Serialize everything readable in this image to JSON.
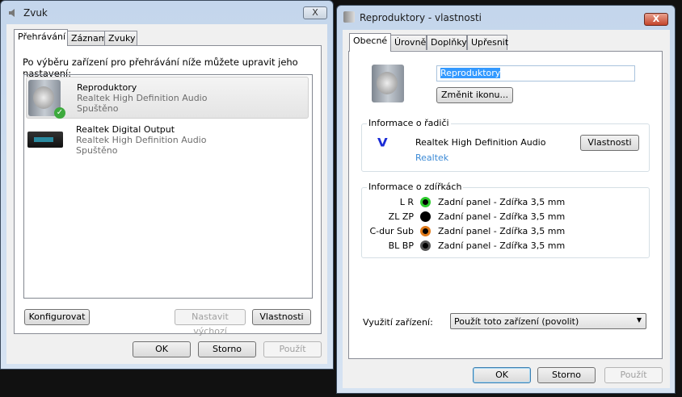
{
  "sound_window": {
    "title": "Zvuk",
    "close_label": "X",
    "tabs": [
      {
        "label": "Přehrávání"
      },
      {
        "label": "Záznam"
      },
      {
        "label": "Zvuky"
      }
    ],
    "description": "Po výběru zařízení pro přehrávání níže můžete upravit jeho nastavení:",
    "devices": [
      {
        "name": "Reproduktory",
        "driver": "Realtek High Definition Audio",
        "status": "Spuštěno",
        "selected": true,
        "default": true
      },
      {
        "name": "Realtek Digital Output",
        "driver": "Realtek High Definition Audio",
        "status": "Spuštěno",
        "selected": false,
        "default": false
      }
    ],
    "configure_label": "Konfigurovat",
    "set_default_label": "Nastavit výchozí",
    "properties_label": "Vlastnosti",
    "ok_label": "OK",
    "cancel_label": "Storno",
    "apply_label": "Použít"
  },
  "props_window": {
    "title": "Reproduktory - vlastnosti",
    "close_label": "X",
    "tabs": [
      {
        "label": "Obecné"
      },
      {
        "label": "Úrovně"
      },
      {
        "label": "Doplňky"
      },
      {
        "label": "Upřesnit"
      }
    ],
    "device_name": "Reproduktory",
    "change_icon_label": "Změnit ikonu...",
    "driver_group": {
      "title": "Informace o řadiči",
      "driver": "Realtek High Definition Audio",
      "vendor": "Realtek",
      "properties_label": "Vlastnosti"
    },
    "jack_group": {
      "title": "Informace o zdířkách",
      "jacks": [
        {
          "channel": "L R",
          "location": "Zadní panel - Zdířka 3,5 mm",
          "color": "#2ecc2e"
        },
        {
          "channel": "ZL ZP",
          "location": "Zadní panel - Zdířka 3,5 mm",
          "color": "#000000"
        },
        {
          "channel": "C-dur Sub",
          "location": "Zadní panel - Zdířka 3,5 mm",
          "color": "#e07a1a"
        },
        {
          "channel": "BL BP",
          "location": "Zadní panel - Zdířka 3,5 mm",
          "color": "#555555"
        }
      ]
    },
    "usage_label": "Využití zařízení:",
    "usage_value": "Použít toto zařízení (povolit)",
    "ok_label": "OK",
    "cancel_label": "Storno",
    "apply_label": "Použít"
  }
}
